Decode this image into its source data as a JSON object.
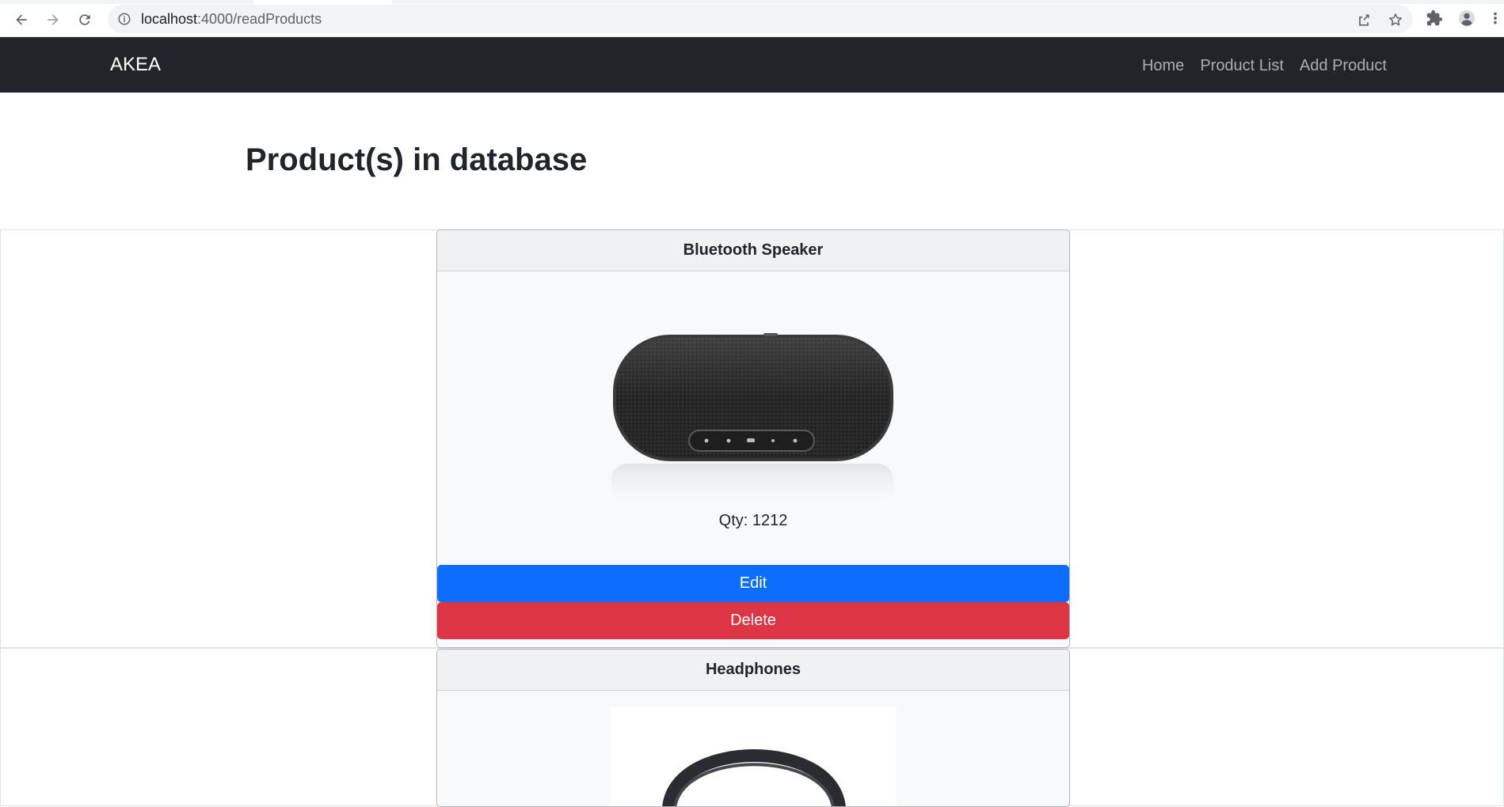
{
  "browser": {
    "url_host": "localhost",
    "url_path": ":4000/readProducts"
  },
  "navbar": {
    "brand": "AKEA",
    "links": [
      "Home",
      "Product List",
      "Add Product"
    ]
  },
  "page": {
    "title": "Product(s) in database"
  },
  "products": [
    {
      "name": "Bluetooth Speaker",
      "qty_label": "Qty: 1212",
      "edit_label": "Edit",
      "delete_label": "Delete",
      "image": "speaker-image"
    },
    {
      "name": "Headphones",
      "image": "headphones-image"
    }
  ],
  "colors": {
    "navbar_bg": "#212529",
    "edit_btn": "#0d6efd",
    "delete_btn": "#dc3545"
  }
}
